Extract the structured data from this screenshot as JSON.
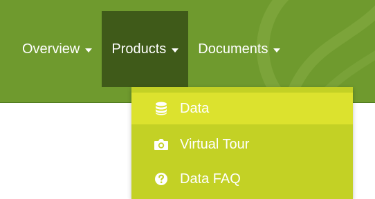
{
  "navbar": {
    "items": [
      {
        "label": "Overview",
        "active": false
      },
      {
        "label": "Products",
        "active": true
      },
      {
        "label": "Documents",
        "active": false
      }
    ]
  },
  "dropdown": {
    "items": [
      {
        "label": "Data",
        "icon": "database-icon",
        "highlighted": true
      },
      {
        "label": "Virtual Tour",
        "icon": "camera-icon",
        "highlighted": false
      },
      {
        "label": "Data FAQ",
        "icon": "question-circle-icon",
        "highlighted": false
      }
    ]
  },
  "colors": {
    "navbar_bg": "#6f9a2e",
    "active_tab_bg": "#3f5a19",
    "dropdown_bg": "#c3d125",
    "dropdown_highlight": "#dce22e",
    "text": "#ffffff"
  }
}
